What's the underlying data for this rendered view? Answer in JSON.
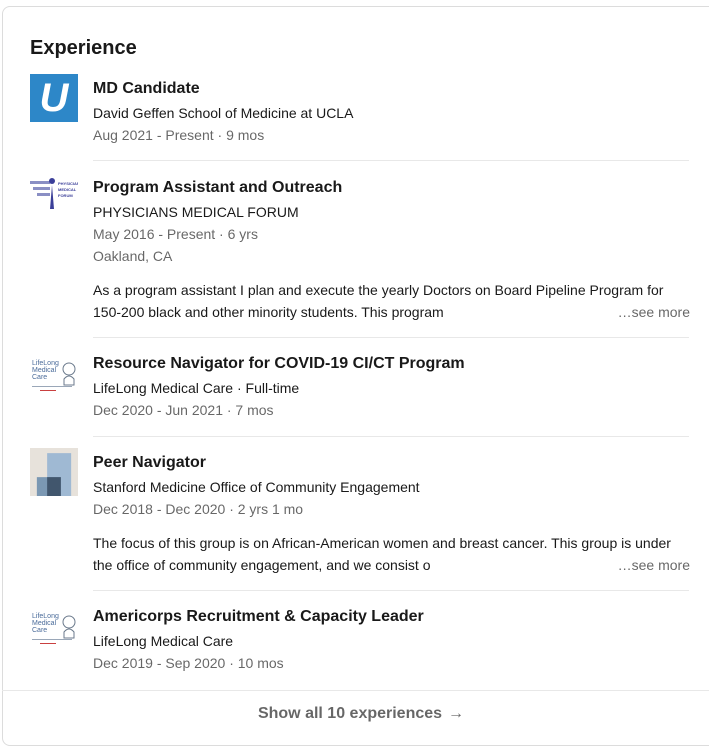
{
  "section": {
    "title": "Experience"
  },
  "experiences": [
    {
      "title": "MD Candidate",
      "company": "David Geffen School of Medicine at UCLA",
      "dates": "Aug 2021 - Present · 9 mos",
      "logo_icon": "ucla-logo-icon",
      "logo_letter": "U"
    },
    {
      "title": "Program Assistant and Outreach",
      "company": "PHYSICIANS MEDICAL FORUM",
      "dates": "May 2016 - Present · 6 yrs",
      "location": "Oakland, CA",
      "description": "As a program assistant I plan and execute the yearly Doctors on Board Pipeline Program for 150-200 black and other minority students. This program",
      "see_more": "…see more",
      "logo_icon": "physicians-medical-forum-logo-icon"
    },
    {
      "title": "Resource Navigator for COVID-19 CI/CT Program",
      "company": "LifeLong Medical Care · Full-time",
      "dates": "Dec 2020 - Jun 2021 · 7 mos",
      "logo_icon": "lifelong-medical-care-logo-icon"
    },
    {
      "title": "Peer Navigator",
      "company": "Stanford Medicine Office of Community Engagement",
      "dates": "Dec 2018 - Dec 2020 · 2 yrs 1 mo",
      "description": "The focus of this group is on African-American women and breast cancer. This group is under the office of community engagement, and we consist o",
      "see_more": "…see more",
      "logo_icon": "stanford-placeholder-logo-icon"
    },
    {
      "title": "Americorps Recruitment & Capacity Leader",
      "company": "LifeLong Medical Care",
      "dates": "Dec 2019 - Sep 2020 · 10 mos",
      "logo_icon": "lifelong-medical-care-logo-icon"
    }
  ],
  "footer": {
    "show_all_label": "Show all 10 experiences",
    "arrow": "→"
  },
  "colors": {
    "ucla_blue": "#2d87c8",
    "text_muted": "#666666",
    "divider": "#e8e8e8"
  }
}
